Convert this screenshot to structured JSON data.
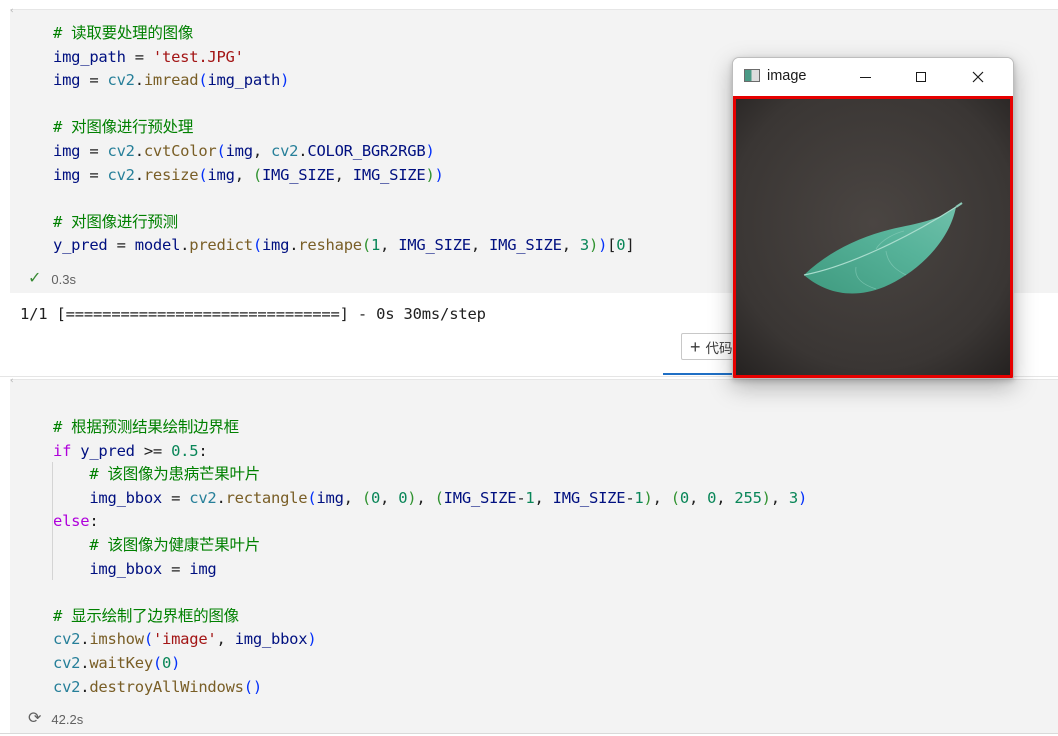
{
  "cell1": {
    "lines": {
      "l1": "# 读取要处理的图像",
      "l3": "# 对图像进行预处理",
      "l6": "# 对图像进行预测"
    },
    "path_string": "'test.JPG'",
    "status_time": "0.3s"
  },
  "output": {
    "text": "1/1 [==============================] - 0s 30ms/step"
  },
  "add_code_button": {
    "label": "代码"
  },
  "cell2": {
    "comments": {
      "c1": "# 根据预测结果绘制边界框",
      "c2": "# 该图像为患病芒果叶片",
      "c3": "# 该图像为健康芒果叶片",
      "c4": "# 显示绘制了边界框的图像"
    },
    "image_string": "'image'",
    "status_time": "42.2s"
  },
  "window": {
    "title": "image",
    "border_color": "#e60000"
  },
  "colors": {
    "comment": "#008000",
    "string": "#a31515",
    "number": "#098658",
    "keyword": "#af00db"
  },
  "icons": {
    "status_done": "check-icon",
    "status_running": "sync-icon",
    "add": "plus-icon"
  }
}
